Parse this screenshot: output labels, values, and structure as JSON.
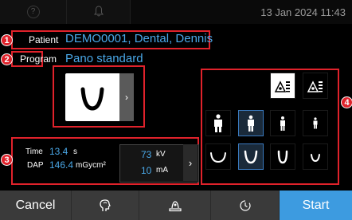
{
  "topbar": {
    "datetime": "13 Jan 2024 11:43",
    "help_icon": "question-circle-icon",
    "bell_icon": "bell-icon"
  },
  "patient": {
    "label": "Patient",
    "value": "DEMO0001, Dental, Dennis"
  },
  "program": {
    "label": "Program",
    "value": "Pano standard",
    "arrow": "›"
  },
  "exposure": {
    "time_label": "Time",
    "time_value": "13.4",
    "time_unit": "s",
    "dap_label": "DAP",
    "dap_value": "146.4",
    "dap_unit": "mGycm²",
    "kv_value": "73",
    "kv_unit": "kV",
    "ma_value": "10",
    "ma_unit": "mA",
    "arrow": "›"
  },
  "callouts": [
    "1",
    "2",
    "3",
    "4"
  ],
  "bottom": {
    "cancel": "Cancel",
    "start": "Start"
  },
  "colors": {
    "accent": "#3d9be0",
    "highlight_red": "#e0222b"
  }
}
